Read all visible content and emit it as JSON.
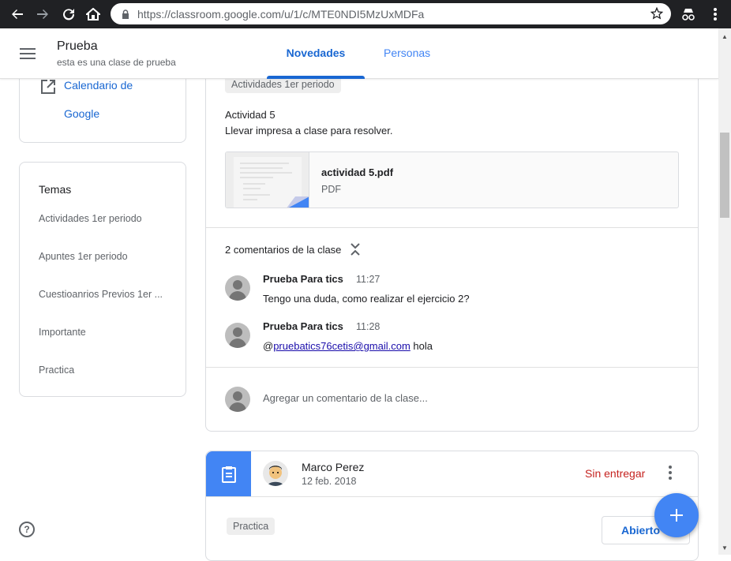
{
  "browser": {
    "url": "https://classroom.google.com/u/1/c/MTE0NDI5MzUxMDFa"
  },
  "header": {
    "class_name": "Prueba",
    "class_description": "esta es una clase de prueba",
    "tabs": [
      {
        "label": "Novedades",
        "active": true
      },
      {
        "label": "Personas",
        "active": false
      }
    ]
  },
  "sidebar": {
    "calendar_link": [
      "Calendario de",
      "Google"
    ],
    "topics_title": "Temas",
    "topics": [
      "Actividades 1er periodo",
      "Apuntes 1er periodo",
      "Cuestioanrios Previos 1er ...",
      "Importante",
      "Practica"
    ]
  },
  "post1": {
    "topic_chip": "Actividades 1er periodo",
    "title": "Actividad 5",
    "description": "Llevar impresa a clase para resolver.",
    "attachment": {
      "name": "actividad 5.pdf",
      "type": "PDF"
    },
    "comments_count": "2 comentarios de la clase",
    "comments": [
      {
        "author": "Prueba Para tics",
        "time": "11:27",
        "text": "Tengo una duda, como realizar el ejercicio 2?"
      },
      {
        "author": "Prueba Para tics",
        "time": "11:28",
        "text_prefix": "@",
        "mention": "pruebatics76cetis@gmail.com",
        "text_suffix": " hola"
      }
    ],
    "add_comment_placeholder": "Agregar un comentario de la clase..."
  },
  "post2": {
    "author": "Marco Perez",
    "date": "12 feb. 2018",
    "status": "Sin entregar",
    "topic_chip": "Practica",
    "open_label": "Abierto"
  },
  "colors": {
    "accent": "#1967d2",
    "fab": "#4285f4",
    "status_missing": "#c5221f"
  }
}
